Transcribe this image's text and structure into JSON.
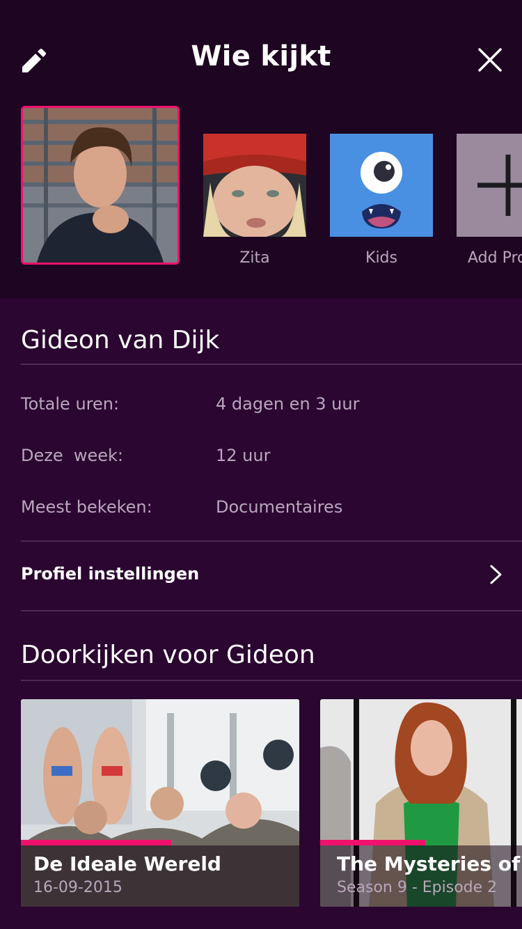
{
  "header": {
    "title": "Wie kijkt"
  },
  "profiles": [
    {
      "name": "",
      "selected": true
    },
    {
      "name": "Zita",
      "selected": false
    },
    {
      "name": "Kids",
      "selected": false
    },
    {
      "name": "Add Pro",
      "selected": false
    }
  ],
  "profile": {
    "name": "Gideon van Dijk",
    "stats": [
      {
        "label": "Totale uren:",
        "value": "4 dagen en 3 uur"
      },
      {
        "label": "Deze  week:",
        "value": "12 uur"
      },
      {
        "label": "Meest bekeken:",
        "value": "Documentaires"
      }
    ],
    "settings_label": "Profiel instellingen"
  },
  "continue": {
    "title": "Doorkijken voor Gideon",
    "items": [
      {
        "title": "De Ideale Wereld",
        "subtitle": "16-09-2015",
        "progress": 0.54
      },
      {
        "title": "The Mysteries of Lau",
        "subtitle": "Season 9 - Episode 2",
        "progress": 0.52
      }
    ]
  },
  "colors": {
    "accent": "#f0116d",
    "background_top": "#1e0521",
    "background_main": "#2b0631",
    "kids_tile": "#4a90e2",
    "add_tile": "#9b8a9e"
  },
  "icons": {
    "edit": "pencil-icon",
    "close": "close-icon",
    "chevron": "chevron-right-icon",
    "add": "plus-icon"
  }
}
